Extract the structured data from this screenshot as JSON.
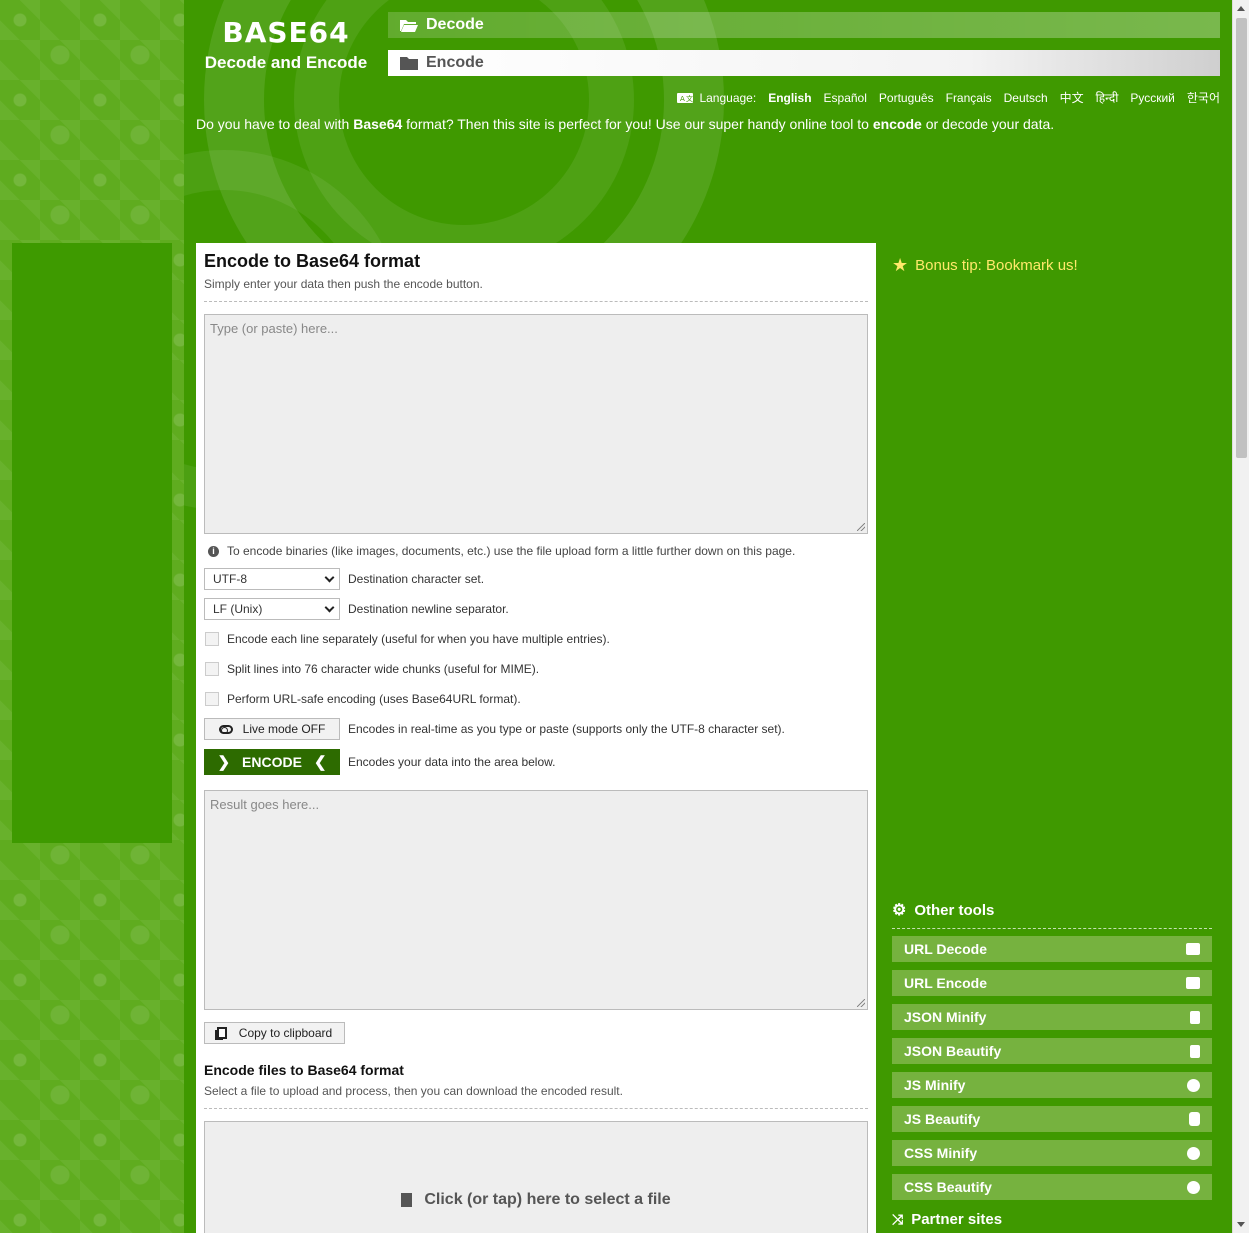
{
  "header": {
    "logo_big": "BASE64",
    "logo_small": "Decode and Encode",
    "nav": [
      {
        "label": "Decode",
        "icon": "folder-open-icon"
      },
      {
        "label": "Encode",
        "icon": "folder-icon"
      }
    ],
    "language_label": "Language:",
    "languages": [
      "English",
      "Español",
      "Português",
      "Français",
      "Deutsch",
      "中文",
      "हिन्दी",
      "Русский",
      "한국어"
    ],
    "active_language": "English",
    "intro": {
      "p1": "Do you have to deal with ",
      "b1": "Base64",
      "p2": " format? Then this site is perfect for you! Use our super handy online tool to ",
      "b2": "encode",
      "p3": " or decode your data."
    }
  },
  "encode": {
    "title": "Encode to Base64 format",
    "subtitle": "Simply enter your data then push the encode button.",
    "input_placeholder": "Type (or paste) here...",
    "info": "To encode binaries (like images, documents, etc.) use the file upload form a little further down on this page.",
    "charset_value": "UTF-8",
    "charset_desc": "Destination character set.",
    "newline_value": "LF (Unix)",
    "newline_desc": "Destination newline separator.",
    "opt_each_line": "Encode each line separately (useful for when you have multiple entries).",
    "opt_split": "Split lines into 76 character wide chunks (useful for MIME).",
    "opt_urlsafe": "Perform URL-safe encoding (uses Base64URL format).",
    "live_label": "Live mode OFF",
    "live_desc": "Encodes in real-time as you type or paste (supports only the UTF-8 character set).",
    "encode_label": "ENCODE",
    "encode_desc": "Encodes your data into the area below.",
    "result_placeholder": "Result goes here...",
    "copy_label": "Copy to clipboard"
  },
  "files": {
    "title": "Encode files to Base64 format",
    "subtitle": "Select a file to upload and process, then you can download the encoded result.",
    "drop_label": "Click (or tap) here to select a file"
  },
  "sidebar": {
    "tip": "Bonus tip: Bookmark us!",
    "other_tools_title": "Other tools",
    "tools": [
      {
        "label": "URL Decode",
        "icon": "envelope-open-icon"
      },
      {
        "label": "URL Encode",
        "icon": "envelope-icon"
      },
      {
        "label": "JSON Minify",
        "icon": "file-icon"
      },
      {
        "label": "JSON Beautify",
        "icon": "file-code-icon"
      },
      {
        "label": "JS Minify",
        "icon": "hand-icon"
      },
      {
        "label": "JS Beautify",
        "icon": "hand-paper-icon"
      },
      {
        "label": "CSS Minify",
        "icon": "smile-icon"
      },
      {
        "label": "CSS Beautify",
        "icon": "smile-icon"
      }
    ],
    "partner_title": "Partner sites"
  },
  "colors": {
    "brand_green": "#3f9900",
    "encode_button": "#2d6b00",
    "tool_item": "#76b23f",
    "tip_yellow": "#ffe96b"
  }
}
